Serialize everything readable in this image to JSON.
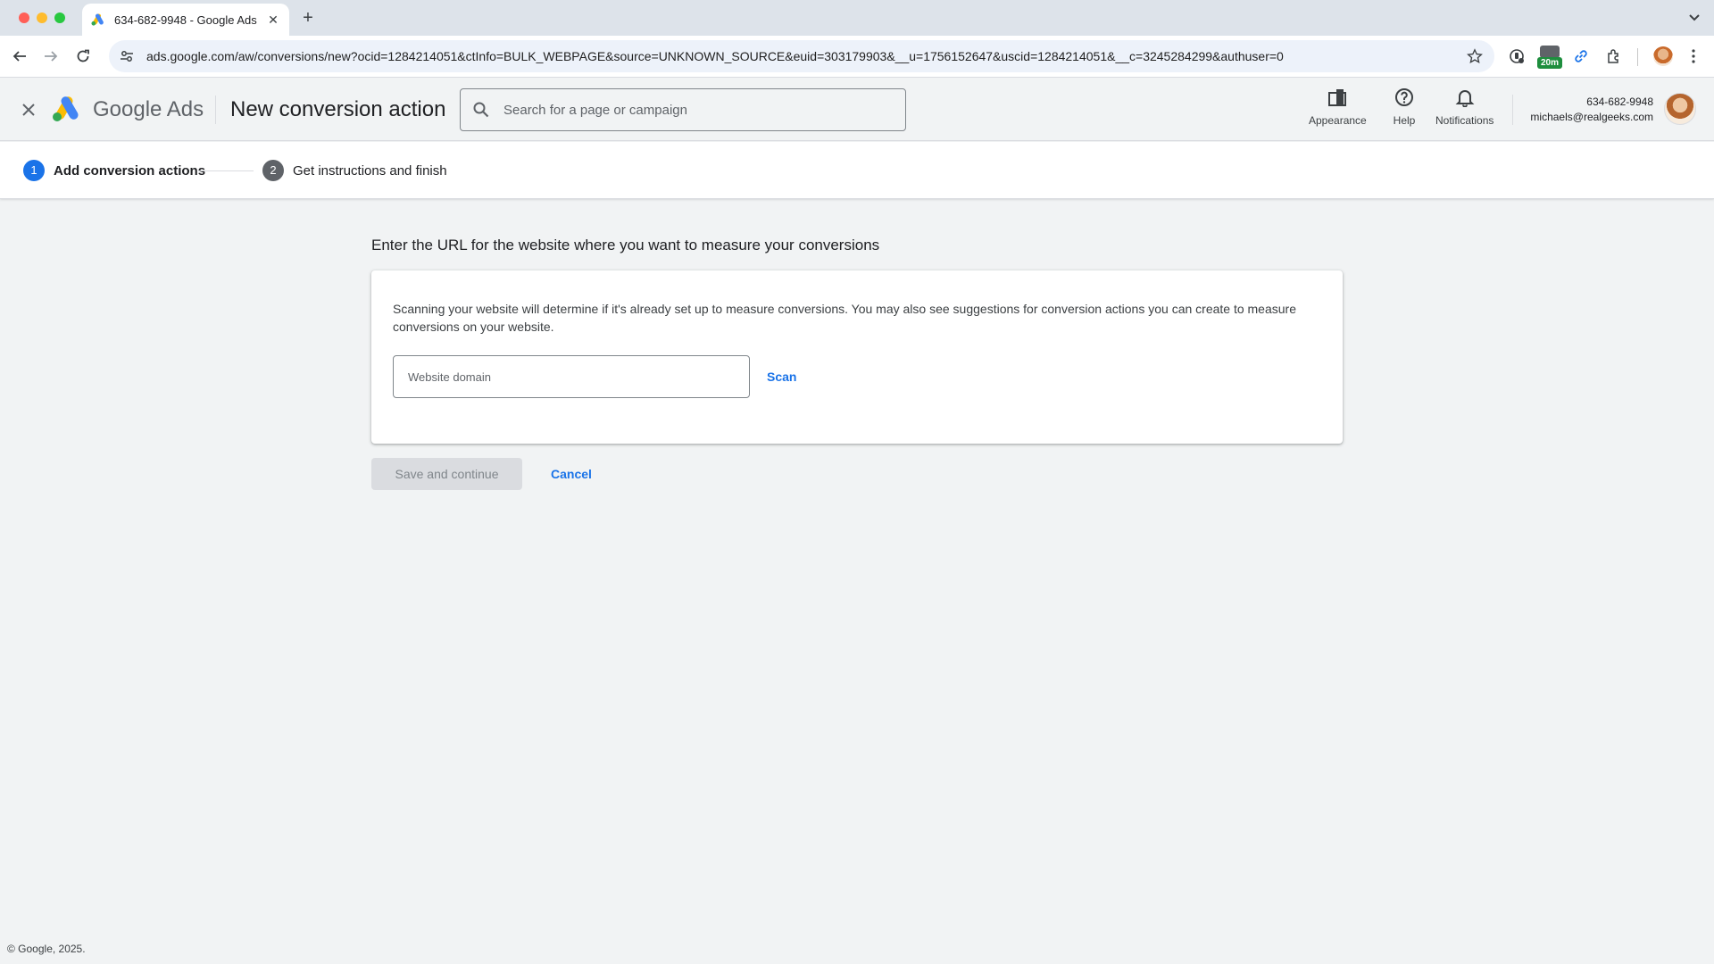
{
  "browser": {
    "tab_title": "634-682-9948 - Google Ads",
    "url": "ads.google.com/aw/conversions/new?ocid=1284214051&ctInfo=BULK_WEBPAGE&source=UNKNOWN_SOURCE&euid=303179903&__u=1756152647&uscid=1284214051&__c=3245284299&authuser=0",
    "extension_badge": "20m"
  },
  "header": {
    "product_name": "Google Ads",
    "page_title": "New conversion action",
    "search_placeholder": "Search for a page or campaign",
    "actions": {
      "appearance": "Appearance",
      "help": "Help",
      "notifications": "Notifications"
    },
    "account_id": "634-682-9948",
    "account_email": "michaels@realgeeks.com"
  },
  "stepper": {
    "steps": [
      {
        "number": "1",
        "label": "Add conversion actions",
        "active": true
      },
      {
        "number": "2",
        "label": "Get instructions and finish",
        "active": false
      }
    ]
  },
  "main": {
    "heading": "Enter the URL for the website where you want to measure your conversions",
    "description": "Scanning your website will determine if it's already set up to measure conversions. You may also see suggestions for conversion actions you can create to measure conversions on your website.",
    "domain_placeholder": "Website domain",
    "domain_value": "",
    "scan_label": "Scan",
    "save_label": "Save and continue",
    "cancel_label": "Cancel"
  },
  "footer": {
    "copyright": "© Google, 2025."
  },
  "colors": {
    "accent_blue": "#1a73e8",
    "ads_yellow": "#fbbc04",
    "ads_blue": "#4285f4",
    "ads_green": "#34a853"
  }
}
